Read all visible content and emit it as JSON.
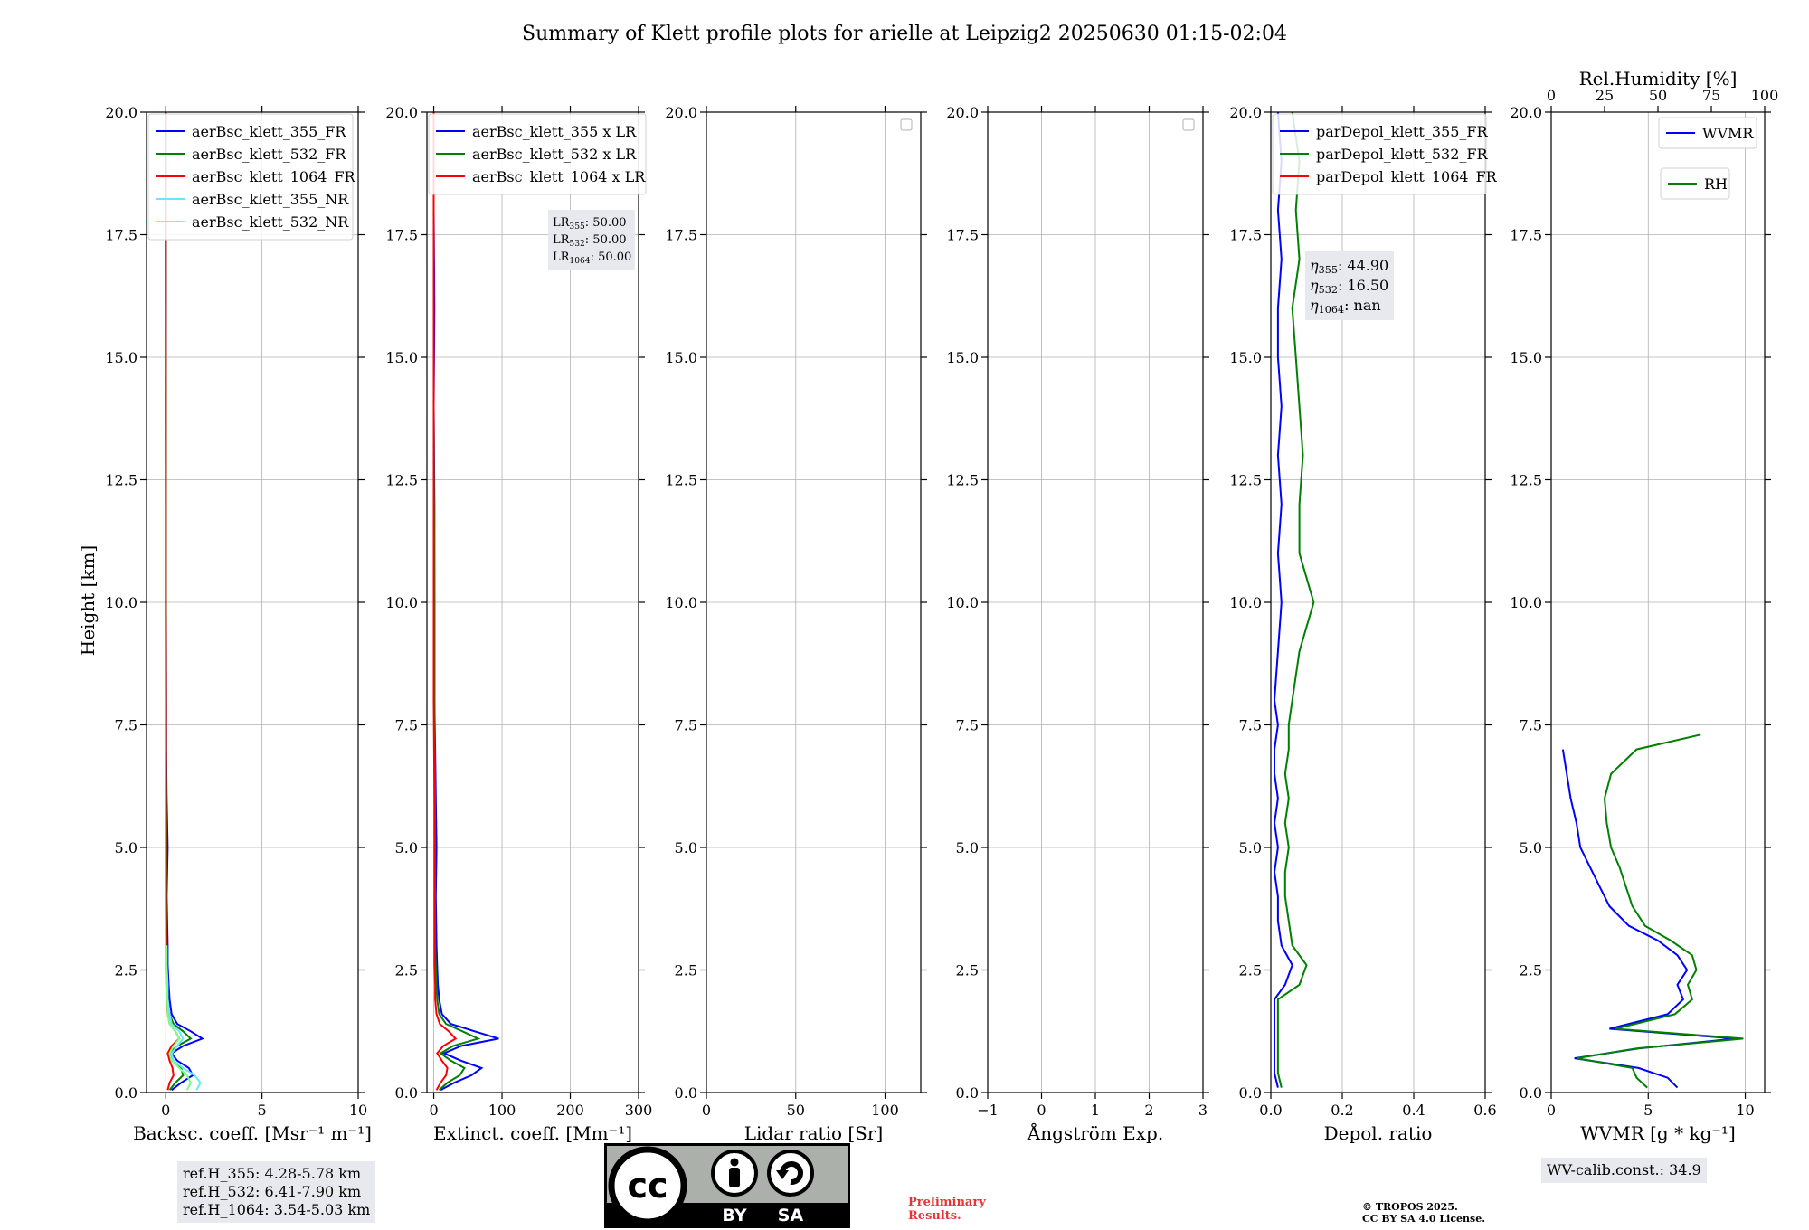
{
  "title": "Summary of Klett profile plots for arielle at Leipzig2 20250630 01:15-02:04",
  "y_axis": {
    "label": "Height [km]",
    "range": [
      0,
      20
    ],
    "ticks": [
      "0.0",
      "2.5",
      "5.0",
      "7.5",
      "10.0",
      "12.5",
      "15.0",
      "17.5",
      "20.0"
    ]
  },
  "chart_data": [
    {
      "type": "line",
      "id": "backscatter",
      "xlabel": "Backsc. coeff. [Msr⁻¹ m⁻¹]",
      "xlim": [
        -1,
        10
      ],
      "xticks": [
        "0",
        "5",
        "10"
      ],
      "legend_location": "top-left",
      "series": [
        {
          "name": "aerBsc_klett_355_FR",
          "color": "#0000ff",
          "y": [
            0.05,
            0.2,
            0.35,
            0.5,
            0.65,
            0.8,
            0.95,
            1.1,
            1.25,
            1.4,
            1.6,
            1.9,
            2.2,
            2.6,
            3.0,
            4.0,
            5.0,
            6.0,
            7.0,
            8.0,
            10.0,
            12.0,
            14.0,
            16.0,
            18.0,
            20.0
          ],
          "x": [
            0.3,
            0.8,
            1.4,
            1.2,
            0.6,
            0.3,
            0.9,
            1.9,
            1.3,
            0.6,
            0.3,
            0.2,
            0.15,
            0.1,
            0.1,
            0.05,
            0.1,
            0.05,
            0.02,
            0.02,
            0.01,
            0.01,
            0.0,
            0.01,
            0.0,
            0.0
          ]
        },
        {
          "name": "aerBsc_klett_532_FR",
          "color": "#008000",
          "y": [
            0.05,
            0.2,
            0.35,
            0.5,
            0.65,
            0.8,
            0.95,
            1.1,
            1.25,
            1.4,
            1.6,
            1.9,
            2.2,
            2.6,
            3.0,
            4.0,
            5.0,
            6.0,
            7.0,
            8.0,
            10.0,
            12.0,
            14.0,
            16.0,
            18.0,
            20.0
          ],
          "x": [
            0.2,
            0.5,
            0.9,
            0.8,
            0.4,
            0.2,
            0.6,
            1.3,
            0.9,
            0.4,
            0.2,
            0.1,
            0.08,
            0.05,
            0.05,
            0.03,
            0.04,
            0.03,
            0.02,
            0.02,
            0.01,
            0.01,
            0.01,
            0.0,
            0.0,
            0.0
          ]
        },
        {
          "name": "aerBsc_klett_1064_FR",
          "color": "#ff0000",
          "y": [
            0.05,
            0.2,
            0.35,
            0.5,
            0.65,
            0.8,
            0.95,
            1.1,
            1.25,
            1.4,
            1.6,
            1.9,
            2.2,
            2.6,
            3.0,
            4.0,
            6.0,
            8.0,
            10.0,
            14.0,
            20.0
          ],
          "x": [
            0.1,
            0.2,
            0.4,
            0.35,
            0.2,
            0.1,
            0.3,
            0.7,
            0.5,
            0.2,
            0.1,
            0.05,
            0.03,
            0.02,
            0.02,
            0.01,
            0.01,
            0.01,
            0.0,
            0.0,
            0.0
          ]
        },
        {
          "name": "aerBsc_klett_355_NR",
          "color": "#66e8ff",
          "y": [
            0.05,
            0.2,
            0.35,
            0.5,
            0.65,
            0.8,
            0.95,
            1.1,
            1.25,
            1.4,
            1.6,
            1.9,
            2.2,
            2.6,
            3.0
          ],
          "x": [
            1.6,
            1.8,
            1.5,
            0.9,
            0.4,
            0.3,
            0.6,
            0.9,
            0.7,
            0.3,
            0.2,
            0.1,
            0.1,
            0.05,
            0.05
          ]
        },
        {
          "name": "aerBsc_klett_532_NR",
          "color": "#80ff80",
          "y": [
            0.05,
            0.2,
            0.35,
            0.5,
            0.65,
            0.8,
            0.95,
            1.1,
            1.25,
            1.4,
            1.6,
            1.9,
            2.2,
            2.6,
            3.0
          ],
          "x": [
            1.1,
            1.3,
            1.1,
            0.7,
            0.3,
            0.2,
            0.4,
            0.7,
            0.5,
            0.2,
            0.1,
            0.08,
            0.06,
            0.04,
            0.04
          ]
        }
      ],
      "annotation": [
        "ref.H_355: 4.28-5.78 km",
        "ref.H_532: 6.41-7.90 km",
        "ref.H_1064: 3.54-5.03 km"
      ]
    },
    {
      "type": "line",
      "id": "extinction",
      "xlabel": "Extinct. coeff. [Mm⁻¹]",
      "xlim": [
        -10,
        300
      ],
      "xticks": [
        "0",
        "100",
        "200",
        "300"
      ],
      "legend_location": "top-left",
      "series": [
        {
          "name": "aerBsc_klett_355 x LR",
          "color": "#0000ff",
          "y": [
            0.05,
            0.2,
            0.35,
            0.5,
            0.65,
            0.8,
            0.95,
            1.1,
            1.25,
            1.4,
            1.6,
            1.9,
            2.2,
            2.6,
            3.0,
            4.0,
            5.0,
            6.0,
            7.0,
            8.0,
            10.0,
            12.0,
            14.0,
            16.0,
            18.0,
            20.0
          ],
          "x": [
            10,
            30,
            55,
            70,
            40,
            15,
            40,
            95,
            60,
            25,
            12,
            8,
            6,
            5,
            4,
            3,
            4,
            3,
            2,
            1,
            1,
            1,
            0,
            1,
            0,
            0
          ]
        },
        {
          "name": "aerBsc_klett_532 x LR",
          "color": "#008000",
          "y": [
            0.05,
            0.2,
            0.35,
            0.5,
            0.65,
            0.8,
            0.95,
            1.1,
            1.25,
            1.4,
            1.6,
            1.9,
            2.2,
            2.6,
            3.0,
            4.0,
            6.0,
            8.0,
            10.0,
            14.0,
            20.0
          ],
          "x": [
            8,
            20,
            38,
            45,
            25,
            10,
            28,
            65,
            42,
            18,
            8,
            5,
            4,
            3,
            2,
            2,
            2,
            1,
            1,
            0,
            0
          ]
        },
        {
          "name": "aerBsc_klett_1064 x LR",
          "color": "#ff0000",
          "y": [
            0.05,
            0.2,
            0.35,
            0.5,
            0.65,
            0.8,
            0.95,
            1.1,
            1.25,
            1.4,
            1.6,
            1.9,
            2.2,
            2.6,
            3.0,
            4.0,
            6.0,
            8.0,
            10.0,
            14.0,
            20.0
          ],
          "x": [
            4,
            10,
            18,
            20,
            12,
            5,
            14,
            32,
            22,
            9,
            4,
            2,
            2,
            1,
            1,
            1,
            1,
            0,
            0,
            0,
            0
          ]
        }
      ],
      "annotation": [
        {
          "sym": "LR",
          "sub": "355",
          "value": ": 50.00"
        },
        {
          "sym": "LR",
          "sub": "532",
          "value": ": 50.00"
        },
        {
          "sym": "LR",
          "sub": "1064",
          "value": ": 50.00"
        }
      ]
    },
    {
      "type": "line",
      "id": "lidar-ratio",
      "xlabel": "Lidar ratio [Sr]",
      "xlim": [
        0,
        120
      ],
      "xticks": [
        "0",
        "50",
        "100"
      ],
      "series": []
    },
    {
      "type": "line",
      "id": "angstrom",
      "xlabel": "Ångström Exp.",
      "xlim": [
        -1,
        3
      ],
      "xticks": [
        "−1",
        "0",
        "1",
        "2",
        "3"
      ],
      "series": []
    },
    {
      "type": "line",
      "id": "depol",
      "xlabel": "Depol. ratio",
      "xlim": [
        0,
        0.6
      ],
      "xticks": [
        "0.0",
        "0.2",
        "0.4",
        "0.6"
      ],
      "legend_location": "top-left",
      "series": [
        {
          "name": "parDepol_klett_355_FR",
          "color": "#0000ff",
          "y": [
            0.1,
            0.4,
            0.8,
            1.2,
            1.6,
            1.9,
            2.2,
            2.6,
            3.0,
            3.5,
            4.0,
            4.5,
            5.0,
            5.5,
            6.0,
            6.5,
            7.0,
            7.5,
            8.0,
            9.0,
            10.0,
            11.0,
            12.0,
            13.0,
            14.0,
            15.0,
            16.0,
            17.0,
            18.0,
            19.0,
            20.0
          ],
          "x": [
            0.02,
            0.01,
            0.01,
            0.01,
            0.01,
            0.01,
            0.04,
            0.06,
            0.03,
            0.02,
            0.02,
            0.01,
            0.02,
            0.01,
            0.02,
            0.01,
            0.01,
            0.02,
            0.01,
            0.02,
            0.03,
            0.02,
            0.03,
            0.02,
            0.03,
            0.02,
            0.02,
            0.03,
            0.02,
            0.03,
            0.02
          ]
        },
        {
          "name": "parDepol_klett_532_FR",
          "color": "#008000",
          "y": [
            0.1,
            0.4,
            0.8,
            1.2,
            1.6,
            1.9,
            2.2,
            2.6,
            3.0,
            3.5,
            4.0,
            4.5,
            5.0,
            5.5,
            6.0,
            6.5,
            7.0,
            7.5,
            8.0,
            9.0,
            10.0,
            11.0,
            12.0,
            13.0,
            14.0,
            15.0,
            16.0,
            17.0,
            18.0,
            19.0,
            20.0
          ],
          "x": [
            0.03,
            0.02,
            0.02,
            0.02,
            0.02,
            0.02,
            0.08,
            0.1,
            0.06,
            0.05,
            0.04,
            0.04,
            0.05,
            0.04,
            0.05,
            0.04,
            0.05,
            0.05,
            0.06,
            0.08,
            0.12,
            0.08,
            0.08,
            0.09,
            0.08,
            0.07,
            0.06,
            0.08,
            0.07,
            0.08,
            0.06
          ]
        },
        {
          "name": "parDepol_klett_1064_FR",
          "color": "#ff0000",
          "y": [],
          "x": []
        }
      ],
      "annotation": [
        {
          "sym": "η",
          "sub": "355",
          "value": ": 44.90"
        },
        {
          "sym": "η",
          "sub": "532",
          "value": ": 16.50"
        },
        {
          "sym": "η",
          "sub": "1064",
          "value": ": nan"
        }
      ]
    },
    {
      "type": "line",
      "id": "wvmr",
      "xlabel": "WVMR [g * kg⁻¹]",
      "xlim": [
        0,
        11
      ],
      "xticks": [
        "0",
        "5",
        "10"
      ],
      "x2label": "Rel.Humidity [%]",
      "x2lim": [
        0,
        100
      ],
      "x2ticks": [
        "0",
        "25",
        "50",
        "75",
        "100"
      ],
      "series": [
        {
          "name": "WVMR",
          "axis": "bottom",
          "color": "#0000ff",
          "y": [
            0.1,
            0.3,
            0.5,
            0.7,
            0.9,
            1.1,
            1.3,
            1.6,
            1.9,
            2.2,
            2.5,
            2.8,
            3.1,
            3.4,
            3.8,
            4.2,
            4.6,
            5.0,
            5.5,
            6.0,
            6.5,
            7.0
          ],
          "x": [
            6.5,
            6.0,
            4.5,
            1.2,
            4.5,
            9.5,
            3.0,
            6.0,
            6.8,
            6.5,
            7.0,
            6.5,
            5.5,
            4.0,
            3.0,
            2.5,
            2.0,
            1.5,
            1.3,
            1.0,
            0.8,
            0.6
          ]
        },
        {
          "name": "RH",
          "axis": "top",
          "color": "#008000",
          "y": [
            0.1,
            0.3,
            0.5,
            0.7,
            0.9,
            1.1,
            1.3,
            1.6,
            1.9,
            2.2,
            2.5,
            2.8,
            3.1,
            3.4,
            3.8,
            4.2,
            4.6,
            5.0,
            5.5,
            6.0,
            6.5,
            7.0,
            7.3
          ],
          "x": [
            45,
            40,
            38,
            12,
            40,
            90,
            30,
            58,
            66,
            64,
            68,
            66,
            56,
            44,
            38,
            35,
            32,
            28,
            26,
            25,
            28,
            40,
            70
          ]
        }
      ],
      "annotation": "WV-calib.const.: 34.9"
    }
  ],
  "footer": {
    "cc_badge": {
      "cc": "cc",
      "by": "BY",
      "sa": "SA"
    },
    "preliminary": [
      "Preliminary",
      "Results."
    ],
    "copyright": [
      "© TROPOS 2025.",
      "CC BY SA 4.0 License."
    ]
  }
}
